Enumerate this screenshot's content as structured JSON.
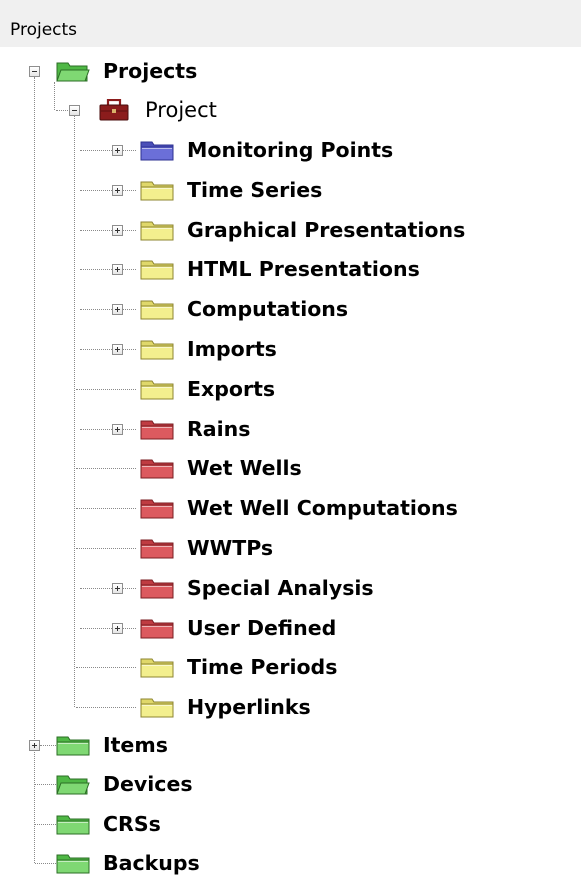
{
  "panel": {
    "title": "Projects"
  },
  "tree": {
    "root": {
      "label": "Projects"
    },
    "project": {
      "label": "Project"
    },
    "project_children": [
      {
        "label": "Monitoring Points",
        "color": "blue",
        "expandable": true
      },
      {
        "label": "Time Series",
        "color": "yellow",
        "expandable": true
      },
      {
        "label": "Graphical Presentations",
        "color": "yellow",
        "expandable": true
      },
      {
        "label": "HTML Presentations",
        "color": "yellow",
        "expandable": true
      },
      {
        "label": "Computations",
        "color": "yellow",
        "expandable": true
      },
      {
        "label": "Imports",
        "color": "yellow",
        "expandable": true
      },
      {
        "label": "Exports",
        "color": "yellow",
        "expandable": false
      },
      {
        "label": "Rains",
        "color": "red",
        "expandable": true
      },
      {
        "label": "Wet Wells",
        "color": "red",
        "expandable": false
      },
      {
        "label": "Wet Well Computations",
        "color": "red",
        "expandable": false
      },
      {
        "label": "WWTPs",
        "color": "red",
        "expandable": false
      },
      {
        "label": "Special Analysis",
        "color": "red",
        "expandable": true
      },
      {
        "label": "User Defined",
        "color": "red",
        "expandable": true
      },
      {
        "label": "Time Periods",
        "color": "yellow",
        "expandable": false
      },
      {
        "label": "Hyperlinks",
        "color": "yellow",
        "expandable": false
      }
    ],
    "top_level": [
      {
        "label": "Items",
        "color": "green",
        "expandable": true,
        "open": false
      },
      {
        "label": "Devices",
        "color": "green",
        "expandable": false,
        "open": true
      },
      {
        "label": "CRSs",
        "color": "green",
        "expandable": false,
        "open": false
      },
      {
        "label": "Backups",
        "color": "green",
        "expandable": false,
        "open": false
      }
    ]
  },
  "colors": {
    "blue": {
      "body": "#6b6fd8",
      "tab": "#4b4fb8",
      "edge": "#2e3192"
    },
    "yellow": {
      "body": "#f3ef8e",
      "tab": "#e0d86a",
      "edge": "#8c8430"
    },
    "red": {
      "body": "#dc5a5f",
      "tab": "#c03c42",
      "edge": "#7a1d22"
    },
    "green": {
      "body": "#7fd873",
      "tab": "#4fb845",
      "edge": "#2b6e25"
    },
    "briefcase": "#8b1c1c"
  }
}
